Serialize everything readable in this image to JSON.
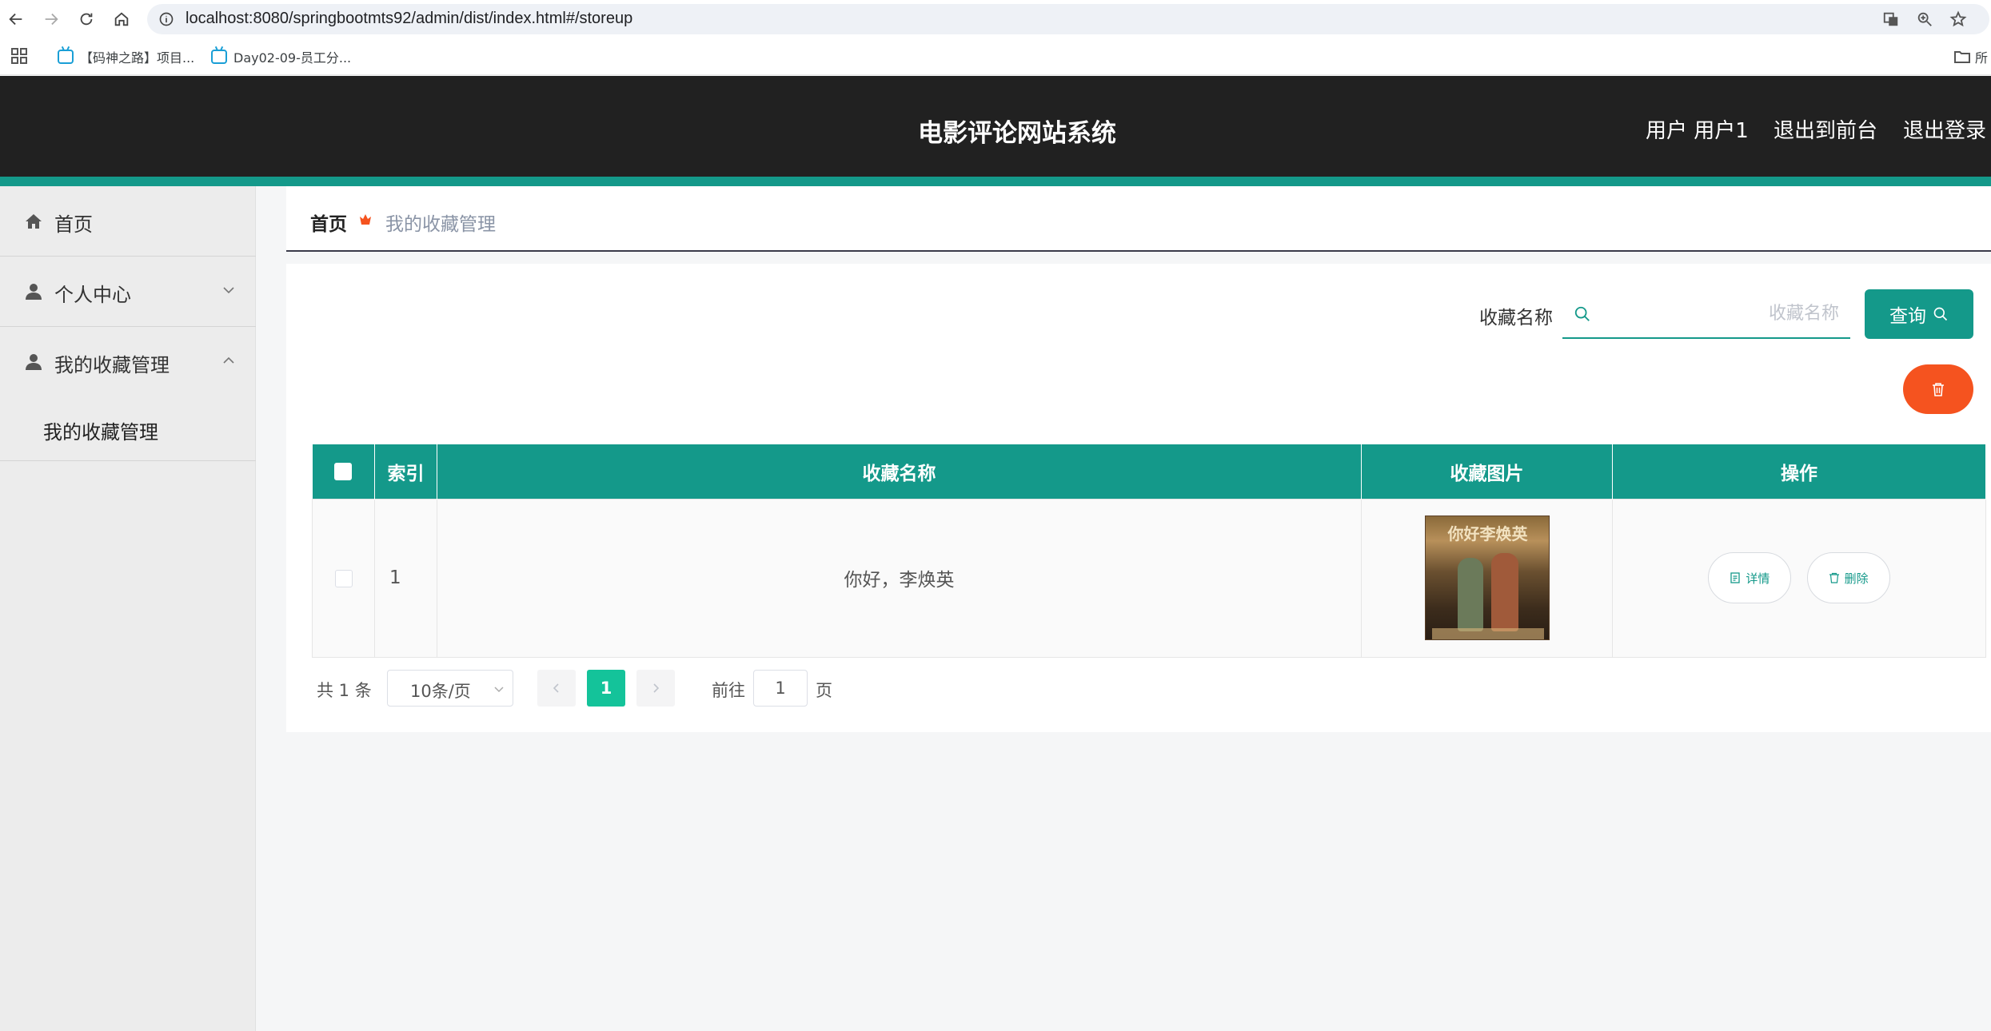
{
  "browser": {
    "url": "localhost:8080/springbootmts92/admin/dist/index.html#/storeup",
    "bookmarks": [
      "【码神之路】项目...",
      "Day02-09-员工分..."
    ],
    "bookmark_folder": "所"
  },
  "header": {
    "title": "电影评论网站系统",
    "user_label": "用户 用户1",
    "back_to_front": "退出到前台",
    "logout": "退出登录"
  },
  "sidebar": {
    "items": [
      {
        "label": "首页",
        "icon": "home-icon"
      },
      {
        "label": "个人中心",
        "icon": "user-icon"
      },
      {
        "label": "我的收藏管理",
        "icon": "user-icon"
      }
    ],
    "subitem": "我的收藏管理"
  },
  "breadcrumb": {
    "home": "首页",
    "current": "我的收藏管理"
  },
  "search": {
    "label": "收藏名称",
    "placeholder": "收藏名称",
    "button": "查询"
  },
  "table": {
    "headers": [
      "索引",
      "收藏名称",
      "收藏图片",
      "操作"
    ],
    "rows": [
      {
        "index": "1",
        "name": "你好，李焕英",
        "poster_title": "你好李焕英"
      }
    ],
    "actions": {
      "detail": "详情",
      "delete": "删除"
    }
  },
  "pagination": {
    "total": "共 1 条",
    "page_size": "10条/页",
    "current_page": "1",
    "goto_prefix": "前往",
    "goto_value": "1",
    "goto_suffix": "页"
  },
  "colors": {
    "accent": "#14998a",
    "danger": "#f5531f",
    "header_bg": "#212121",
    "page_active": "#14c39a"
  }
}
